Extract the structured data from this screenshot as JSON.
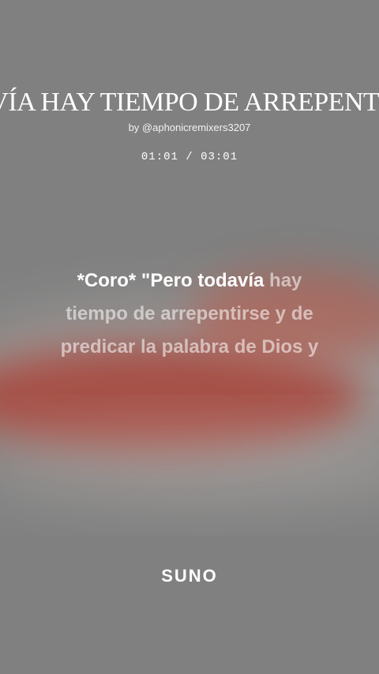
{
  "song": {
    "title": "AVÍA HAY TIEMPO DE ARREPENTIR",
    "byline": "by @aphonicremixers3207",
    "time": "01:01 / 03:01"
  },
  "lyrics": {
    "line1_sung": "*Coro* \"Pero todavía",
    "line1_rest": " hay",
    "line2": "tiempo de arrepentirse y de",
    "line3": "predicar la palabra de Dios y"
  },
  "branding": {
    "logo": "SUNO"
  },
  "colors": {
    "background": "#808080",
    "blob": "#a8453a"
  }
}
